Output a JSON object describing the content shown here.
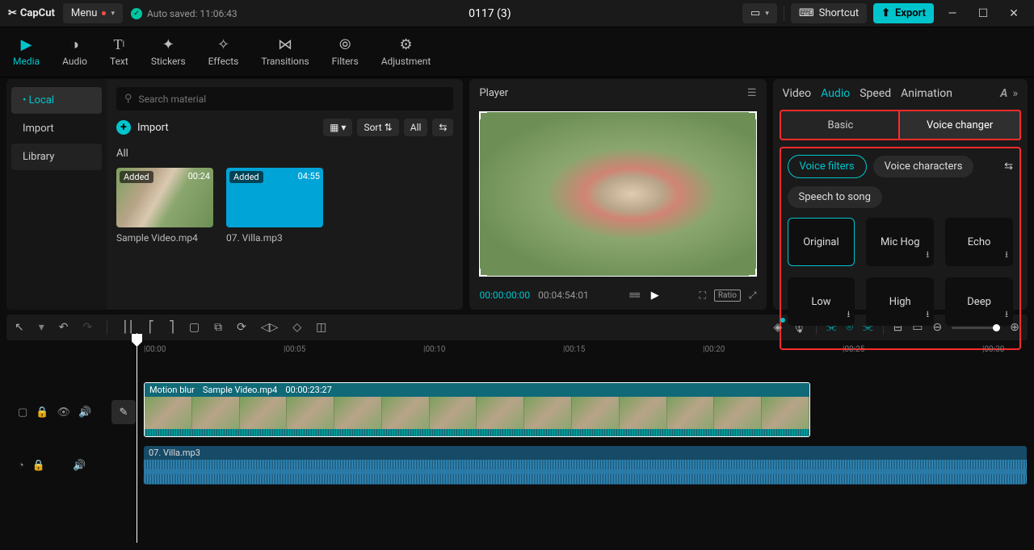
{
  "titlebar": {
    "logo_text": "CapCut",
    "menu_label": "Menu",
    "autosave_label": "Auto saved: 11:06:43",
    "title": "0117 (3)",
    "shortcut_label": "Shortcut",
    "export_label": "Export"
  },
  "top_tabs": {
    "media": "Media",
    "audio": "Audio",
    "text": "Text",
    "stickers": "Stickers",
    "effects": "Effects",
    "transitions": "Transitions",
    "filters": "Filters",
    "adjustment": "Adjustment"
  },
  "sidebar": {
    "local": "Local",
    "import": "Import",
    "library": "Library"
  },
  "media_panel": {
    "search_placeholder": "Search material",
    "import_label": "Import",
    "sort_label": "Sort",
    "all_label": "All",
    "section_label": "All",
    "items": [
      {
        "added": "Added",
        "duration": "00:24",
        "name": "Sample Video.mp4"
      },
      {
        "added": "Added",
        "duration": "04:55",
        "name": "07. Villa.mp3"
      }
    ]
  },
  "player": {
    "title": "Player",
    "current_time": "00:00:00:00",
    "total_time": "00:04:54:01",
    "ratio_label": "Ratio"
  },
  "right_panel": {
    "tabs": {
      "video": "Video",
      "audio": "Audio",
      "speed": "Speed",
      "animation": "Animation"
    },
    "subtabs": {
      "basic": "Basic",
      "voice_changer": "Voice changer"
    },
    "chips": {
      "voice_filters": "Voice filters",
      "voice_characters": "Voice characters",
      "speech_to_song": "Speech to song"
    },
    "voices": [
      "Original",
      "Mic Hog",
      "Echo",
      "Low",
      "High",
      "Deep"
    ]
  },
  "ruler": {
    "marks": [
      "|00:00",
      "|00:05",
      "|00:10",
      "|00:15",
      "|00:20",
      "|00:25",
      "|00:30"
    ]
  },
  "timeline": {
    "video_clip": {
      "effect": "Motion blur",
      "name": "Sample Video.mp4",
      "duration": "00:00:23:27"
    },
    "audio_clip": {
      "name": "07. Villa.mp3"
    }
  }
}
